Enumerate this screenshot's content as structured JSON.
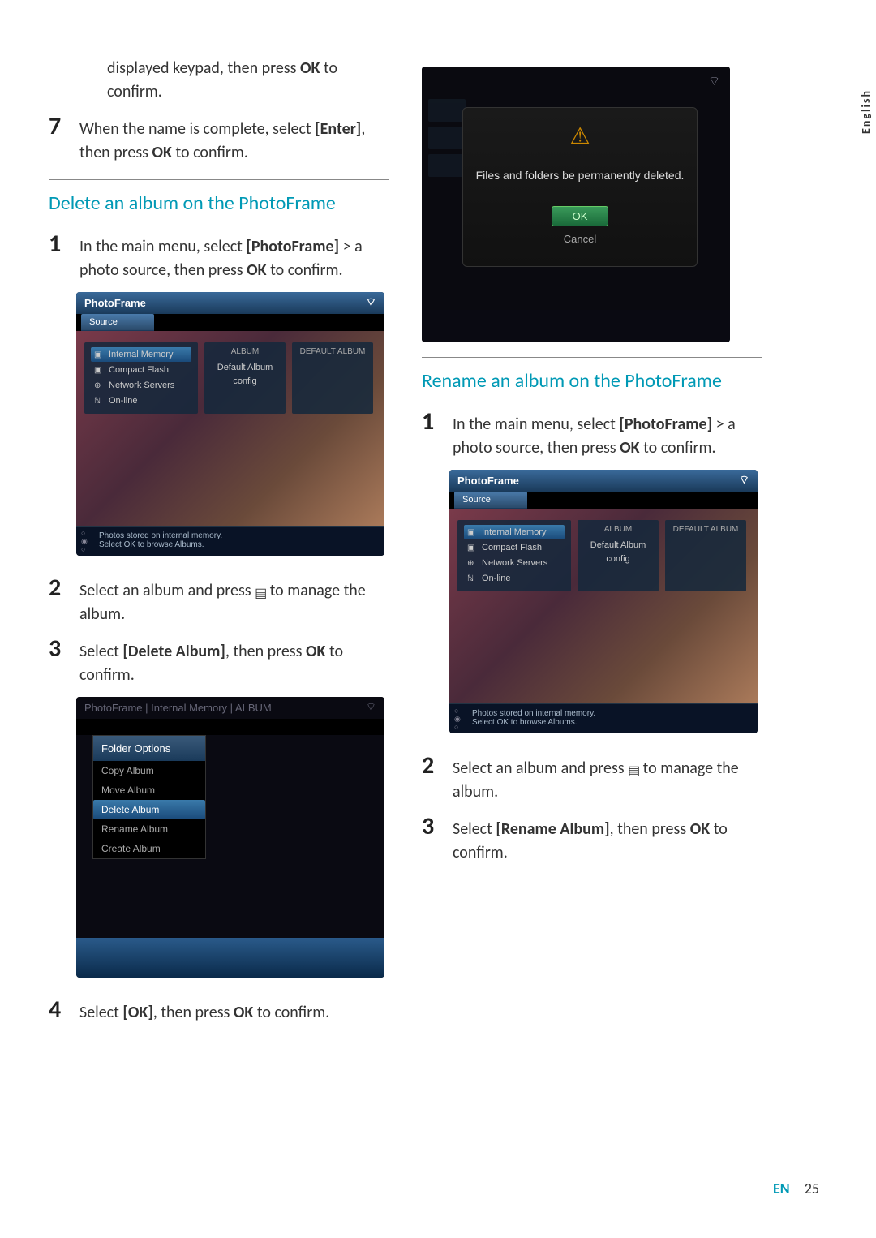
{
  "lang_tab": "English",
  "left": {
    "continuation": "displayed keypad, then press",
    "continuation_bold": "OK",
    "continuation_end": "to confirm.",
    "step7_num": "7",
    "step7_a": "When the name is complete, select",
    "step7_bold": "[Enter]",
    "step7_b": ", then press",
    "step7_bold2": "OK",
    "step7_c": "to confirm.",
    "section1_title": "Delete an album on the PhotoFrame",
    "s1_step1_num": "1",
    "s1_step1_a": "In the main menu, select",
    "s1_step1_bold": "[PhotoFrame]",
    "s1_step1_b": "> a photo source, then press",
    "s1_step1_bold2": "OK",
    "s1_step1_c": "to confirm.",
    "s1_step2_num": "2",
    "s1_step2_a": "Select an album and press",
    "s1_step2_b": "to manage the album.",
    "s1_step3_num": "3",
    "s1_step3_a": "Select",
    "s1_step3_bold": "[Delete Album]",
    "s1_step3_b": ", then press",
    "s1_step3_bold2": "OK",
    "s1_step3_c": "to confirm.",
    "s1_step4_num": "4",
    "s1_step4_a": "Select",
    "s1_step4_bold": "[OK]",
    "s1_step4_b": ", then press",
    "s1_step4_bold2": "OK",
    "s1_step4_c": "to confirm."
  },
  "right": {
    "section2_title": "Rename an album on the PhotoFrame",
    "s2_step1_num": "1",
    "s2_step1_a": "In the main menu, select",
    "s2_step1_bold": "[PhotoFrame]",
    "s2_step1_b": "> a photo source, then press",
    "s2_step1_bold2": "OK",
    "s2_step1_c": "to confirm.",
    "s2_step2_num": "2",
    "s2_step2_a": "Select an album and press",
    "s2_step2_b": "to manage the album.",
    "s2_step3_num": "3",
    "s2_step3_a": "Select",
    "s2_step3_bold": "[Rename Album]",
    "s2_step3_b": ", then press",
    "s2_step3_bold2": "OK",
    "s2_step3_c": "to confirm."
  },
  "device_source": {
    "title": "PhotoFrame",
    "tab": "Source",
    "items": [
      "Internal Memory",
      "Compact Flash",
      "Network Servers",
      "On-line"
    ],
    "col2_label": "ALBUM",
    "col2_items": [
      "Default Album",
      "config"
    ],
    "col3_label": "Default Album",
    "footer1": "Photos stored on internal memory.",
    "footer2": "Select OK to browse Albums."
  },
  "device_folder": {
    "crumb": "PhotoFrame | Internal Memory | ALBUM",
    "header": "Folder Options",
    "options": [
      "Copy Album",
      "Move Album",
      "Delete Album",
      "Rename Album",
      "Create Album"
    ],
    "selected_index": 2
  },
  "device_dialog": {
    "msg": "Files and folders be permanently deleted.",
    "ok": "OK",
    "cancel": "Cancel"
  },
  "footer": {
    "lang": "EN",
    "page": "25"
  }
}
